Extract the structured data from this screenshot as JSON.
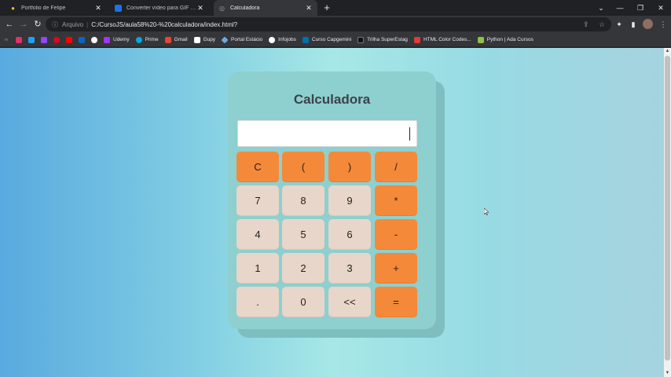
{
  "browser": {
    "tabs": [
      {
        "title": "Portfolio de Felipe",
        "icon": "bulb-icon"
      },
      {
        "title": "Converter vídeo para GIF animado",
        "icon": "converter-icon"
      },
      {
        "title": "Calculadora",
        "icon": "globe-icon",
        "active": true
      }
    ],
    "new_tab": "+",
    "window": {
      "minimize": "—",
      "restore": "❐",
      "close": "✕"
    },
    "address": {
      "scheme": "Arquivo",
      "separator": "|",
      "url": "C:/CursoJS/aula58%20-%20calculadora/index.html?"
    },
    "bookmarks": [
      {
        "label": "",
        "icon": "instagram-icon",
        "color": "#e1306c"
      },
      {
        "label": "",
        "icon": "twitter-icon",
        "color": "#1da1f2"
      },
      {
        "label": "",
        "icon": "twitch-icon",
        "color": "#9146ff"
      },
      {
        "label": "",
        "icon": "pinterest-icon",
        "color": "#e60023"
      },
      {
        "label": "",
        "icon": "youtube-icon",
        "color": "#ff0000"
      },
      {
        "label": "",
        "icon": "linkedin-icon",
        "color": "#0a66c2"
      },
      {
        "label": "",
        "icon": "github-icon",
        "color": "#ffffff"
      },
      {
        "label": "Udemy",
        "icon": "udemy-icon",
        "color": "#a435f0"
      },
      {
        "label": "Prime",
        "icon": "prime-icon",
        "color": "#00a8e1"
      },
      {
        "label": "Gmail",
        "icon": "gmail-icon",
        "color": "#ea4335"
      },
      {
        "label": "Guру",
        "icon": "gupy-icon",
        "color": "#ffffff"
      },
      {
        "label": "Portal Estácio",
        "icon": "estacio-icon",
        "color": "#6fa8dc"
      },
      {
        "label": "Infojobs",
        "icon": "infojobs-icon",
        "color": "#ffffff"
      },
      {
        "label": "Curso Capgemini",
        "icon": "capgemini-icon",
        "color": "#0070ad"
      },
      {
        "label": "Trilha SuperEstag",
        "icon": "superestag-icon",
        "color": "#222222"
      },
      {
        "label": "HTML Color Codes...",
        "icon": "htmlcolor-icon",
        "color": "#e53935"
      },
      {
        "label": "Python | Ada Cursos",
        "icon": "ada-icon",
        "color": "#8bc34a"
      }
    ]
  },
  "calculator": {
    "title": "Calculadora",
    "display_value": "",
    "colors": {
      "operator_key": "#f5893a",
      "number_key": "#e7d6c9",
      "body": "#8ecfcf",
      "title": "#3c4349"
    },
    "keys": [
      {
        "label": "C",
        "kind": "op",
        "name": "clear"
      },
      {
        "label": "(",
        "kind": "op",
        "name": "open-paren"
      },
      {
        "label": ")",
        "kind": "op",
        "name": "close-paren"
      },
      {
        "label": "/",
        "kind": "op",
        "name": "divide"
      },
      {
        "label": "7",
        "kind": "num",
        "name": "7"
      },
      {
        "label": "8",
        "kind": "num",
        "name": "8"
      },
      {
        "label": "9",
        "kind": "num",
        "name": "9"
      },
      {
        "label": "*",
        "kind": "op",
        "name": "multiply"
      },
      {
        "label": "4",
        "kind": "num",
        "name": "4"
      },
      {
        "label": "5",
        "kind": "num",
        "name": "5"
      },
      {
        "label": "6",
        "kind": "num",
        "name": "6"
      },
      {
        "label": "-",
        "kind": "op",
        "name": "subtract"
      },
      {
        "label": "1",
        "kind": "num",
        "name": "1"
      },
      {
        "label": "2",
        "kind": "num",
        "name": "2"
      },
      {
        "label": "3",
        "kind": "num",
        "name": "3"
      },
      {
        "label": "+",
        "kind": "op",
        "name": "add"
      },
      {
        "label": ".",
        "kind": "num",
        "name": "decimal"
      },
      {
        "label": "0",
        "kind": "num",
        "name": "0"
      },
      {
        "label": "<<",
        "kind": "num",
        "name": "backspace"
      },
      {
        "label": "=",
        "kind": "op",
        "name": "equals"
      }
    ]
  }
}
